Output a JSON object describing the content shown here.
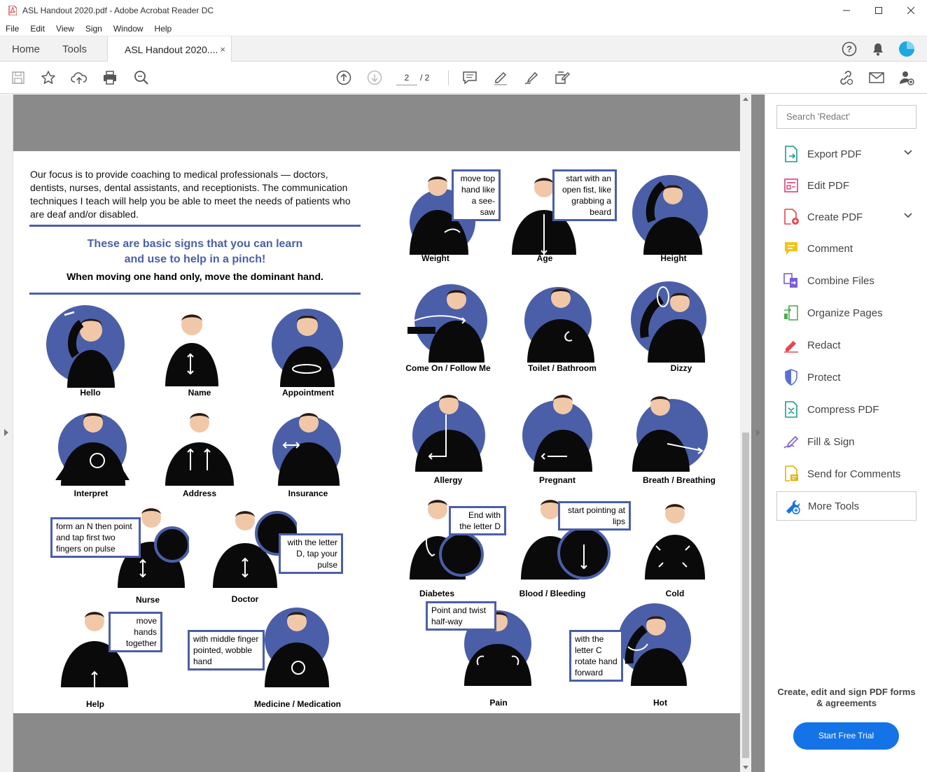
{
  "window": {
    "title": "ASL Handout 2020.pdf - Adobe Acrobat Reader DC",
    "controls": [
      "minimize",
      "maximize",
      "close"
    ]
  },
  "menu": [
    "File",
    "Edit",
    "View",
    "Sign",
    "Window",
    "Help"
  ],
  "tabs": {
    "home": "Home",
    "tools": "Tools",
    "doc": "ASL Handout 2020....",
    "close": "×"
  },
  "toolbar": {
    "page_current": "2",
    "page_total": "/ 2",
    "icons": [
      "save-icon",
      "bookmark-star-icon",
      "upload-cloud-icon",
      "print-icon",
      "zoom-icon",
      "page-up-icon",
      "page-down-icon",
      "comment-icon",
      "highlight-pen-icon",
      "sign-pen-icon",
      "edit-stamp-icon",
      "share-link-icon",
      "email-icon",
      "add-user-icon"
    ]
  },
  "document": {
    "intro": "Our focus is to provide coaching to medical professionals — doctors, dentists, nurses, dental assistants, and receptionists.  The communication techniques I teach will help you be able to meet the needs of patients who are deaf and/or disabled.",
    "subhead_line1": "These are basic signs that you can learn",
    "subhead_line2": "and use to help in a pinch!",
    "subnote": "When moving one hand only, move the dominant hand.",
    "signs": {
      "hello": "Hello",
      "name": "Name",
      "appointment": "Appointment",
      "interpret": "Interpret",
      "address": "Address",
      "insurance": "Insurance",
      "nurse": "Nurse",
      "doctor": "Doctor",
      "help": "Help",
      "medicine": "Medicine / Medication",
      "weight": "Weight",
      "age": "Age",
      "height": "Height",
      "come_on": "Come On / Follow Me",
      "toilet": "Toilet / Bathroom",
      "dizzy": "Dizzy",
      "allergy": "Allergy",
      "pregnant": "Pregnant",
      "breath": "Breath / Breathing",
      "diabetes": "Diabetes",
      "blood": "Blood / Bleeding",
      "cold": "Cold",
      "pain": "Pain",
      "hot": "Hot"
    },
    "callouts": {
      "nurse": "form an N then point and tap first two fingers on pulse",
      "doctor": "with the letter D, tap your pulse",
      "help": "move hands together",
      "medicine": "with middle finger pointed, wobble hand",
      "weight": "move top hand like a see-saw",
      "age": "start with an open fist, like grabbing a beard",
      "diabetes": "End with the letter D",
      "blood": "start pointing at lips",
      "pain": "Point and twist half-way",
      "hot": "with the letter C rotate hand forward"
    }
  },
  "right_panel": {
    "search_placeholder": "Search 'Redact'",
    "tools": [
      {
        "label": "Export PDF",
        "color": "#1a9c8f",
        "chevron": true
      },
      {
        "label": "Edit PDF",
        "color": "#e03c7d",
        "chevron": false
      },
      {
        "label": "Create PDF",
        "color": "#e34850",
        "chevron": true
      },
      {
        "label": "Comment",
        "color": "#f0c419",
        "chevron": false
      },
      {
        "label": "Combine Files",
        "color": "#7b5cd6",
        "chevron": false
      },
      {
        "label": "Organize Pages",
        "color": "#4caf50",
        "chevron": false
      },
      {
        "label": "Redact",
        "color": "#e34850",
        "chevron": false
      },
      {
        "label": "Protect",
        "color": "#5a6fd6",
        "chevron": false
      },
      {
        "label": "Compress PDF",
        "color": "#1a9c8f",
        "chevron": false
      },
      {
        "label": "Fill & Sign",
        "color": "#7b5cd6",
        "chevron": false
      },
      {
        "label": "Send for Comments",
        "color": "#e0b400",
        "chevron": false
      },
      {
        "label": "More Tools",
        "color": "#1473e6",
        "chevron": false
      }
    ],
    "promo": "Create, edit and sign PDF forms & agreements",
    "trial_button": "Start Free Trial"
  }
}
